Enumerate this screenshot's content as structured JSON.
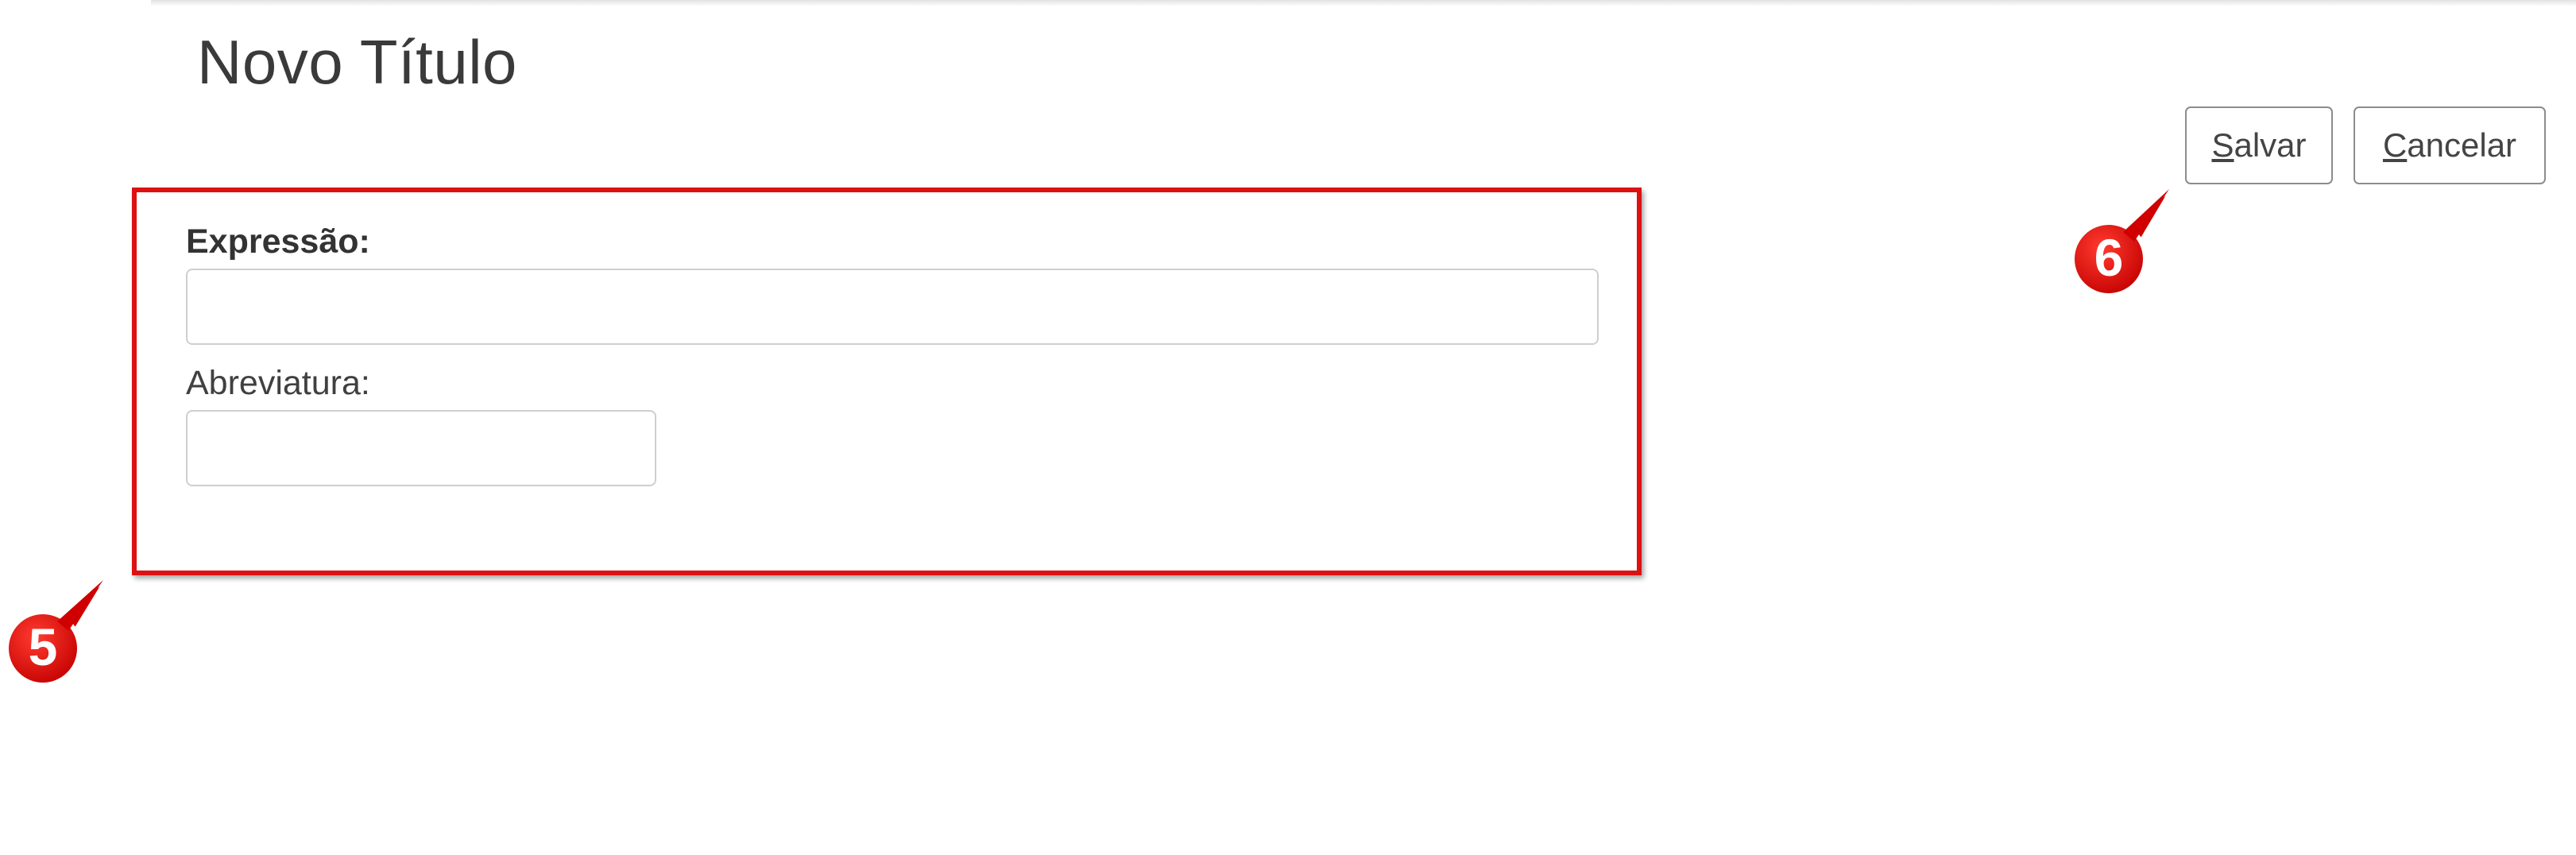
{
  "page": {
    "title": "Novo Título"
  },
  "toolbar": {
    "save_mnemonic": "S",
    "save_rest": "alvar",
    "cancel_mnemonic": "C",
    "cancel_rest": "ancelar"
  },
  "form": {
    "expressao_label": "Expressão:",
    "expressao_value": "",
    "abreviatura_label": "Abreviatura:",
    "abreviatura_value": ""
  },
  "annotations": {
    "callout_5": "5",
    "callout_6": "6",
    "highlight_color": "#dd1111"
  }
}
